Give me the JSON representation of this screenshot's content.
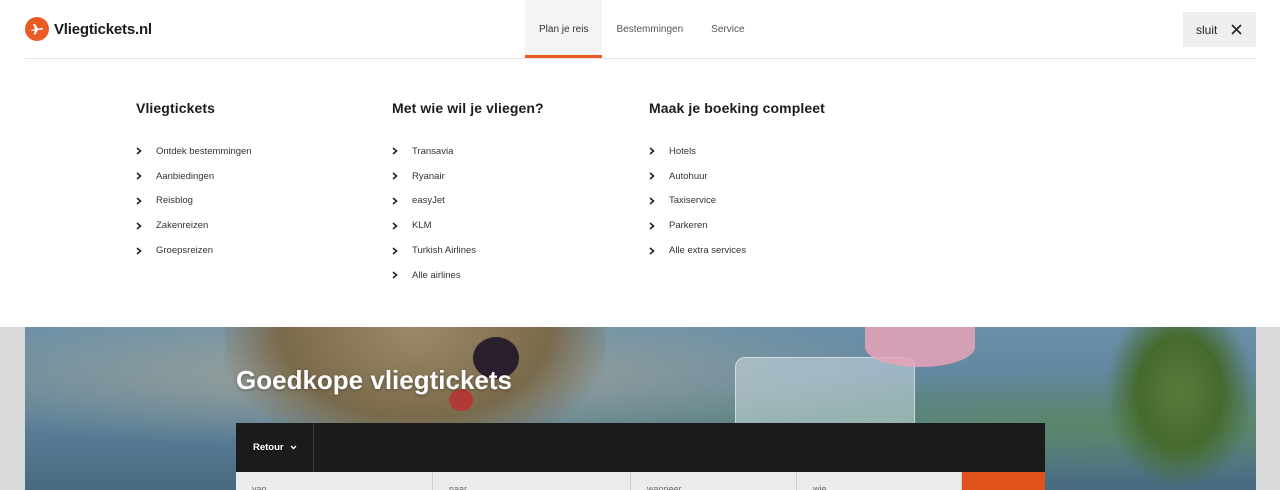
{
  "header": {
    "logo_text": "Vliegtickets.nl",
    "nav": [
      {
        "label": "Plan je reis",
        "active": true
      },
      {
        "label": "Bestemmingen",
        "active": false
      },
      {
        "label": "Service",
        "active": false
      }
    ],
    "close_label": "sluit"
  },
  "menu": {
    "columns": [
      {
        "title": "Vliegtickets",
        "items": [
          "Ontdek bestemmingen",
          "Aanbiedingen",
          "Reisblog",
          "Zakenreizen",
          "Groepsreizen"
        ]
      },
      {
        "title": "Met wie wil je vliegen?",
        "items": [
          "Transavia",
          "Ryanair",
          "easyJet",
          "KLM",
          "Turkish Airlines",
          "Alle airlines"
        ]
      },
      {
        "title": "Maak je boeking compleet",
        "items": [
          "Hotels",
          "Autohuur",
          "Taxiservice",
          "Parkeren",
          "Alle extra services"
        ]
      }
    ]
  },
  "hero": {
    "title": "Goedkope vliegtickets",
    "trip_type": "Retour",
    "fields": [
      "van",
      "naar",
      "wanneer",
      "wie"
    ]
  },
  "colors": {
    "accent": "#ec5a24",
    "search_bar": "#1b1b1b"
  }
}
